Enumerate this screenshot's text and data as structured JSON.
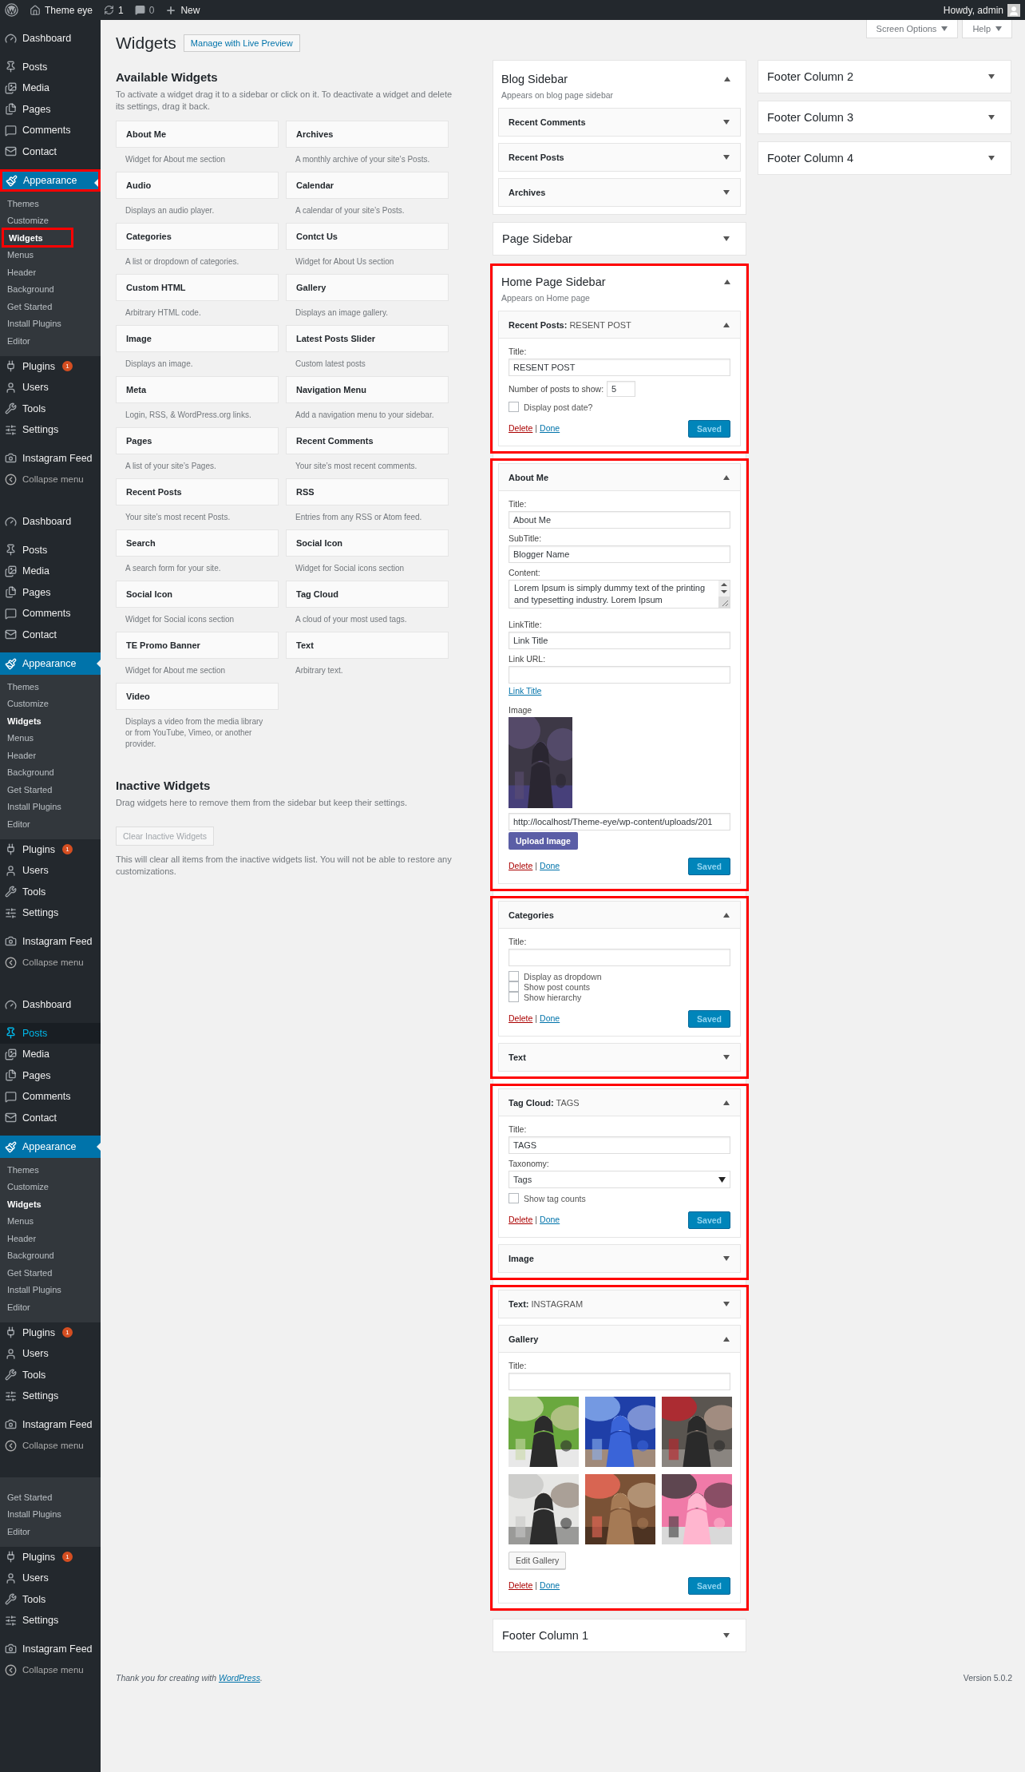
{
  "admin_bar": {
    "site": "Theme eye",
    "updates": "1",
    "comments": "0",
    "new": "New",
    "greeting": "Howdy, admin"
  },
  "screen_meta": [
    {
      "label": "Screen Options"
    },
    {
      "label": "Help"
    }
  ],
  "menu": [
    {
      "items": [
        {
          "kind": "top",
          "label": "Dashboard",
          "selected": false,
          "hovered": false,
          "framed": false
        },
        {
          "kind": "separator"
        },
        {
          "kind": "top",
          "label": "Posts",
          "selected": false,
          "hovered": false,
          "framed": false
        },
        {
          "kind": "top",
          "label": "Media",
          "selected": false,
          "hovered": false,
          "framed": false
        },
        {
          "kind": "top",
          "label": "Pages",
          "selected": false,
          "hovered": false,
          "framed": false
        },
        {
          "kind": "top",
          "label": "Comments",
          "selected": false,
          "hovered": false,
          "framed": false
        },
        {
          "kind": "top",
          "label": "Contact",
          "selected": false,
          "hovered": false,
          "framed": false
        },
        {
          "kind": "separator"
        },
        {
          "kind": "top",
          "label": "Appearance",
          "selected": true,
          "hovered": false,
          "framed": true
        },
        {
          "kind": "submenu",
          "items": [
            {
              "label": "Themes",
              "selected": false,
              "framed": false
            },
            {
              "label": "Customize",
              "selected": false,
              "framed": false
            },
            {
              "label": "Widgets",
              "selected": true,
              "framed": true
            },
            {
              "label": "Menus",
              "selected": false,
              "framed": false
            },
            {
              "label": "Header",
              "selected": false,
              "framed": false
            },
            {
              "label": "Background",
              "selected": false,
              "framed": false
            },
            {
              "label": "Get Started",
              "selected": false,
              "framed": false
            },
            {
              "label": "Install Plugins",
              "selected": false,
              "framed": false
            },
            {
              "label": "Editor",
              "selected": false,
              "framed": false
            }
          ]
        },
        {
          "kind": "top",
          "label": "Plugins",
          "badge": "1",
          "selected": false,
          "hovered": false,
          "framed": false
        },
        {
          "kind": "top",
          "label": "Users",
          "selected": false,
          "hovered": false,
          "framed": false
        },
        {
          "kind": "top",
          "label": "Tools",
          "selected": false,
          "hovered": false,
          "framed": false
        },
        {
          "kind": "top",
          "label": "Settings",
          "selected": false,
          "hovered": false,
          "framed": false
        },
        {
          "kind": "separator"
        },
        {
          "kind": "top",
          "label": "Instagram Feed",
          "selected": false,
          "hovered": false,
          "framed": false
        },
        {
          "kind": "collapse",
          "label": "Collapse menu"
        }
      ]
    },
    {
      "items": [
        {
          "kind": "top",
          "label": "Dashboard",
          "selected": false,
          "hovered": false,
          "framed": false
        },
        {
          "kind": "separator"
        },
        {
          "kind": "top",
          "label": "Posts",
          "selected": false,
          "hovered": false,
          "framed": false
        },
        {
          "kind": "top",
          "label": "Media",
          "selected": false,
          "hovered": false,
          "framed": false
        },
        {
          "kind": "top",
          "label": "Pages",
          "selected": false,
          "hovered": false,
          "framed": false
        },
        {
          "kind": "top",
          "label": "Comments",
          "selected": false,
          "hovered": false,
          "framed": false
        },
        {
          "kind": "top",
          "label": "Contact",
          "selected": false,
          "hovered": false,
          "framed": false
        },
        {
          "kind": "separator"
        },
        {
          "kind": "top",
          "label": "Appearance",
          "selected": true,
          "hovered": false,
          "framed": false
        },
        {
          "kind": "submenu",
          "items": [
            {
              "label": "Themes",
              "selected": false,
              "framed": false
            },
            {
              "label": "Customize",
              "selected": false,
              "framed": false
            },
            {
              "label": "Widgets",
              "selected": true,
              "framed": false
            },
            {
              "label": "Menus",
              "selected": false,
              "framed": false
            },
            {
              "label": "Header",
              "selected": false,
              "framed": false
            },
            {
              "label": "Background",
              "selected": false,
              "framed": false
            },
            {
              "label": "Get Started",
              "selected": false,
              "framed": false
            },
            {
              "label": "Install Plugins",
              "selected": false,
              "framed": false
            },
            {
              "label": "Editor",
              "selected": false,
              "framed": false
            }
          ]
        },
        {
          "kind": "top",
          "label": "Plugins",
          "badge": "1",
          "selected": false,
          "hovered": false,
          "framed": false
        },
        {
          "kind": "top",
          "label": "Users",
          "selected": false,
          "hovered": false,
          "framed": false
        },
        {
          "kind": "top",
          "label": "Tools",
          "selected": false,
          "hovered": false,
          "framed": false
        },
        {
          "kind": "top",
          "label": "Settings",
          "selected": false,
          "hovered": false,
          "framed": false
        },
        {
          "kind": "separator"
        },
        {
          "kind": "top",
          "label": "Instagram Feed",
          "selected": false,
          "hovered": false,
          "framed": false
        },
        {
          "kind": "collapse",
          "label": "Collapse menu"
        }
      ]
    },
    {
      "items": [
        {
          "kind": "top",
          "label": "Dashboard",
          "selected": false,
          "hovered": false,
          "framed": false
        },
        {
          "kind": "separator"
        },
        {
          "kind": "top",
          "label": "Posts",
          "selected": false,
          "hovered": true,
          "framed": false
        },
        {
          "kind": "top",
          "label": "Media",
          "selected": false,
          "hovered": false,
          "framed": false
        },
        {
          "kind": "top",
          "label": "Pages",
          "selected": false,
          "hovered": false,
          "framed": false
        },
        {
          "kind": "top",
          "label": "Comments",
          "selected": false,
          "hovered": false,
          "framed": false
        },
        {
          "kind": "top",
          "label": "Contact",
          "selected": false,
          "hovered": false,
          "framed": false
        },
        {
          "kind": "separator"
        },
        {
          "kind": "top",
          "label": "Appearance",
          "selected": true,
          "hovered": false,
          "framed": false
        },
        {
          "kind": "submenu",
          "items": [
            {
              "label": "Themes",
              "selected": false,
              "framed": false
            },
            {
              "label": "Customize",
              "selected": false,
              "framed": false
            },
            {
              "label": "Widgets",
              "selected": true,
              "framed": false
            },
            {
              "label": "Menus",
              "selected": false,
              "framed": false
            },
            {
              "label": "Header",
              "selected": false,
              "framed": false
            },
            {
              "label": "Background",
              "selected": false,
              "framed": false
            },
            {
              "label": "Get Started",
              "selected": false,
              "framed": false
            },
            {
              "label": "Install Plugins",
              "selected": false,
              "framed": false
            },
            {
              "label": "Editor",
              "selected": false,
              "framed": false
            }
          ]
        },
        {
          "kind": "top",
          "label": "Plugins",
          "badge": "1",
          "selected": false,
          "hovered": false,
          "framed": false
        },
        {
          "kind": "top",
          "label": "Users",
          "selected": false,
          "hovered": false,
          "framed": false
        },
        {
          "kind": "top",
          "label": "Tools",
          "selected": false,
          "hovered": false,
          "framed": false
        },
        {
          "kind": "top",
          "label": "Settings",
          "selected": false,
          "hovered": false,
          "framed": false
        },
        {
          "kind": "separator"
        },
        {
          "kind": "top",
          "label": "Instagram Feed",
          "selected": false,
          "hovered": false,
          "framed": false
        },
        {
          "kind": "collapse",
          "label": "Collapse menu"
        }
      ]
    },
    {
      "items": [
        {
          "kind": "submenu",
          "items": [
            {
              "label": "Get Started",
              "selected": false,
              "framed": false
            },
            {
              "label": "Install Plugins",
              "selected": false,
              "framed": false
            },
            {
              "label": "Editor",
              "selected": false,
              "framed": false
            }
          ]
        },
        {
          "kind": "top",
          "label": "Plugins",
          "badge": "1",
          "selected": false,
          "hovered": false,
          "framed": false
        },
        {
          "kind": "top",
          "label": "Users",
          "selected": false,
          "hovered": false,
          "framed": false
        },
        {
          "kind": "top",
          "label": "Tools",
          "selected": false,
          "hovered": false,
          "framed": false
        },
        {
          "kind": "top",
          "label": "Settings",
          "selected": false,
          "hovered": false,
          "framed": false
        },
        {
          "kind": "separator"
        },
        {
          "kind": "top",
          "label": "Instagram Feed",
          "selected": false,
          "hovered": false,
          "framed": false
        },
        {
          "kind": "collapse",
          "label": "Collapse menu"
        }
      ]
    }
  ],
  "page": {
    "title": "Widgets",
    "preview_button": "Manage with Live Preview"
  },
  "available": {
    "heading": "Available Widgets",
    "description": "To activate a widget drag it to a sidebar or click on it. To deactivate a widget and delete its settings, drag it back.",
    "widgets": [
      {
        "name": "About Me",
        "description": "Widget for About me section"
      },
      {
        "name": "Archives",
        "description": "A monthly archive of your site’s Posts."
      },
      {
        "name": "Audio",
        "description": "Displays an audio player."
      },
      {
        "name": "Calendar",
        "description": "A calendar of your site’s Posts."
      },
      {
        "name": "Categories",
        "description": "A list or dropdown of categories."
      },
      {
        "name": "Contct Us",
        "description": "Widget for About Us section"
      },
      {
        "name": "Custom HTML",
        "description": "Arbitrary HTML code."
      },
      {
        "name": "Gallery",
        "description": "Displays an image gallery."
      },
      {
        "name": "Image",
        "description": "Displays an image."
      },
      {
        "name": "Latest Posts Slider",
        "description": "Custom latest posts"
      },
      {
        "name": "Meta",
        "description": "Login, RSS, & WordPress.org links."
      },
      {
        "name": "Navigation Menu",
        "description": "Add a navigation menu to your sidebar."
      },
      {
        "name": "Pages",
        "description": "A list of your site’s Pages."
      },
      {
        "name": "Recent Comments",
        "description": "Your site’s most recent comments."
      },
      {
        "name": "Recent Posts",
        "description": "Your site’s most recent Posts."
      },
      {
        "name": "RSS",
        "description": "Entries from any RSS or Atom feed."
      },
      {
        "name": "Search",
        "description": "A search form for your site."
      },
      {
        "name": "Social Icon",
        "description": "Widget for Social icons section"
      },
      {
        "name": "Social Icon",
        "description": "Widget for Social icons section"
      },
      {
        "name": "Tag Cloud",
        "description": "A cloud of your most used tags."
      },
      {
        "name": "TE Promo Banner",
        "description": "Widget for About me section"
      },
      {
        "name": "Text",
        "description": "Arbitrary text."
      },
      {
        "name": "Video",
        "description": "Displays a video from the media library or from YouTube, Vimeo, or another provider."
      }
    ]
  },
  "inactive": {
    "heading": "Inactive Widgets",
    "description": "Drag widgets here to remove them from the sidebar but keep their settings.",
    "button": "Clear Inactive Widgets",
    "button_disabled": true,
    "note": "This will clear all items from the inactive widgets list. You will not be able to restore any customizations."
  },
  "columns": [
    [
      {
        "title": "Blog Sidebar",
        "description": "Appears on blog page sidebar",
        "expanded": true,
        "groups": [
          {
            "highlighted": false,
            "widgets": [
              {
                "title": "Recent Comments",
                "expanded": false
              },
              {
                "title": "Recent Posts",
                "expanded": false
              },
              {
                "title": "Archives",
                "expanded": false
              }
            ]
          }
        ]
      },
      {
        "title": "Page Sidebar",
        "expanded": false
      },
      {
        "title": "Home Page Sidebar",
        "description": "Appears on Home page",
        "expanded": true,
        "groups": [
          {
            "highlighted": true,
            "widgets": [
              {
                "title": "Recent Posts:",
                "subtitle": "RESENT POST",
                "expanded": true,
                "fields": [
                  {
                    "kind": "text",
                    "label": "Title:",
                    "value": "RESENT POST"
                  },
                  {
                    "kind": "number",
                    "label": "Number of posts to show:",
                    "value": "5"
                  },
                  {
                    "kind": "checkbox",
                    "label": "Display post date?",
                    "checked": false
                  }
                ],
                "actions": {
                  "delete": "Delete",
                  "separator": "|",
                  "done": "Done",
                  "save": "Saved"
                }
              }
            ]
          },
          {
            "highlighted": true,
            "widgets": [
              {
                "title": "About Me",
                "expanded": true,
                "fields": [
                  {
                    "kind": "text",
                    "label": "Title:",
                    "value": "About Me"
                  },
                  {
                    "kind": "text",
                    "label": "SubTitle:",
                    "value": "Blogger Name"
                  },
                  {
                    "kind": "textarea",
                    "label": "Content:",
                    "value": "Lorem Ipsum is simply dummy text of the printing and typesetting industry. Lorem Ipsum"
                  },
                  {
                    "kind": "text",
                    "label": "LinkTitle:",
                    "value": "Link Title"
                  },
                  {
                    "kind": "text",
                    "label": "Link URL:"
                  },
                  {
                    "kind": "link",
                    "text": "Link Title"
                  },
                  {
                    "label": "Image"
                  },
                  {
                    "kind": "text",
                    "value": "http://localhost/Theme-eye/wp-content/uploads/201"
                  },
                  {
                    "kind": "upload_button",
                    "label": "Upload Image"
                  }
                ],
                "actions": {
                  "delete": "Delete",
                  "separator": "|",
                  "done": "Done",
                  "save": "Saved"
                }
              }
            ]
          },
          {
            "highlighted": true,
            "widgets": [
              {
                "title": "Categories",
                "expanded": true,
                "fields": [
                  {
                    "kind": "text",
                    "label": "Title:"
                  },
                  {
                    "kind": "checkbox",
                    "label": "Display as dropdown",
                    "checked": false
                  },
                  {
                    "kind": "checkbox",
                    "label": "Show post counts",
                    "checked": false
                  },
                  {
                    "kind": "checkbox",
                    "label": "Show hierarchy",
                    "checked": false
                  }
                ],
                "actions": {
                  "delete": "Delete",
                  "separator": "|",
                  "done": "Done",
                  "save": "Saved"
                }
              },
              {
                "title": "Text",
                "expanded": false
              }
            ]
          },
          {
            "highlighted": true,
            "widgets": [
              {
                "title": "Tag Cloud:",
                "subtitle": "TAGS",
                "expanded": true,
                "fields": [
                  {
                    "kind": "text",
                    "label": "Title:",
                    "value": "TAGS"
                  },
                  {
                    "kind": "select",
                    "label": "Taxonomy:",
                    "value": "Tags"
                  },
                  {
                    "kind": "checkbox",
                    "label": "Show tag counts",
                    "checked": false
                  }
                ],
                "actions": {
                  "delete": "Delete",
                  "separator": "|",
                  "done": "Done",
                  "save": "Saved"
                }
              },
              {
                "title": "Image",
                "expanded": false
              }
            ]
          },
          {
            "highlighted": true,
            "widgets": [
              {
                "title": "Text:",
                "subtitle": "INSTAGRAM",
                "expanded": false
              },
              {
                "title": "Gallery",
                "expanded": true,
                "fields": [
                  {
                    "kind": "text",
                    "label": "Title:"
                  },
                  {
                    "kind": "gallery"
                  },
                  {
                    "kind": "plain_button",
                    "label": "Edit Gallery"
                  }
                ],
                "actions": {
                  "delete": "Delete",
                  "separator": "|",
                  "done": "Done",
                  "save": "Saved"
                }
              }
            ]
          }
        ]
      },
      {
        "title": "Footer Column 1",
        "expanded": false
      }
    ],
    [
      {
        "title": "Footer Column 2",
        "expanded": false
      },
      {
        "title": "Footer Column 3",
        "expanded": false
      },
      {
        "title": "Footer Column 4",
        "expanded": false
      }
    ]
  ],
  "footer": {
    "text_before": "Thank you for creating with ",
    "link": "WordPress",
    "text_after": ".",
    "version": "Version 5.0.2"
  }
}
